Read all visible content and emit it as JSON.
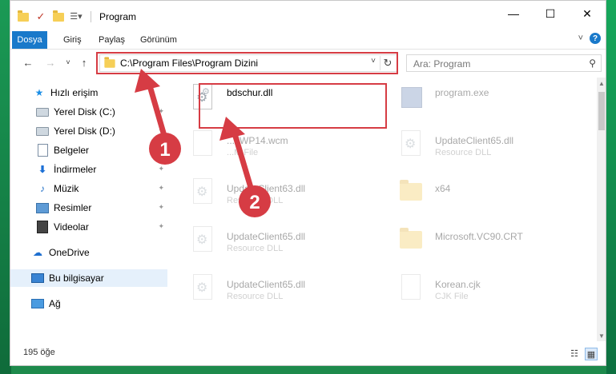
{
  "titlebar": {
    "title": "Program",
    "minimize": "—",
    "maximize": "☐",
    "close": "✕"
  },
  "ribbon": {
    "tabs": [
      "Dosya",
      "Giriş",
      "Paylaş",
      "Görünüm"
    ],
    "expand": "˅",
    "help": "?"
  },
  "address": {
    "path": "C:\\Program Files\\Program Dizini",
    "dropdown": "˅",
    "refresh": "↻"
  },
  "search": {
    "placeholder": "Ara: Program"
  },
  "nav": {
    "back": "←",
    "forward": "→",
    "recent": "˅",
    "up": "↑"
  },
  "sidebar": {
    "items": [
      {
        "label": "Hızlı erişim",
        "icon": "star-icon"
      },
      {
        "label": "Yerel Disk (C:)",
        "icon": "drive-icon"
      },
      {
        "label": "Yerel Disk (D:)",
        "icon": "drive-icon"
      },
      {
        "label": "Belgeler",
        "icon": "documents-icon"
      },
      {
        "label": "İndirmeler",
        "icon": "downloads-icon"
      },
      {
        "label": "Müzik",
        "icon": "music-icon"
      },
      {
        "label": "Resimler",
        "icon": "pictures-icon"
      },
      {
        "label": "Videolar",
        "icon": "videos-icon"
      },
      {
        "label": "OneDrive",
        "icon": "cloud-icon"
      },
      {
        "label": "Bu bilgisayar",
        "icon": "computer-icon"
      },
      {
        "label": "Ağ",
        "icon": "network-icon"
      }
    ]
  },
  "files": [
    {
      "name": "bdschur.dll",
      "type": ""
    },
    {
      "name": "program.exe",
      "type": ""
    },
    {
      "name": "...xWP14.wcm",
      "type": "...M File"
    },
    {
      "name": "UpdateClient65.dll",
      "type": "Resource DLL"
    },
    {
      "name": "UpdateClient63.dll",
      "type": "Resource DLL"
    },
    {
      "name": "x64",
      "type": ""
    },
    {
      "name": "UpdateClient65.dll",
      "type": "Resource DLL"
    },
    {
      "name": "Microsoft.VC90.CRT",
      "type": ""
    },
    {
      "name": "UpdateClient65.dll",
      "type": "Resource DLL"
    },
    {
      "name": "Korean.cjk",
      "type": "CJK File"
    }
  ],
  "status": {
    "count": "195 öğe"
  },
  "annotations": {
    "step1": "1",
    "step2": "2",
    "color": "#d63c44"
  }
}
